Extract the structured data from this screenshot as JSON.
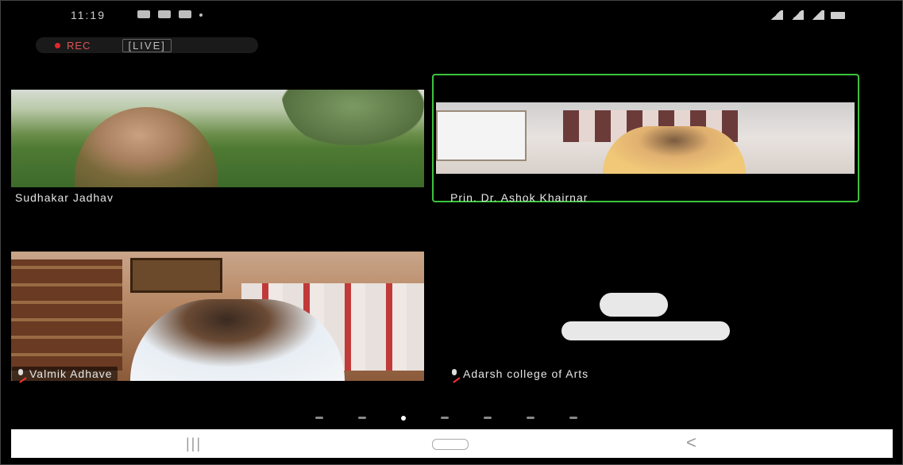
{
  "status_bar": {
    "time": "11:19"
  },
  "recording": {
    "rec_label": "REC",
    "live_label": "[LIVE]"
  },
  "participants": [
    {
      "name": "Sudhakar Jadhav"
    },
    {
      "name": "Prin. Dr. Ashok Khairnar",
      "active_speaker": true,
      "highlight_color": "#3cc43c"
    },
    {
      "name": "Valmik Adhave",
      "muted": true
    },
    {
      "name": "Adarsh college of  Arts",
      "muted": true,
      "video_off": true
    }
  ],
  "pager": {
    "total_pages": 7,
    "current_page": 3
  },
  "navigation": {
    "recents_icon": "recents-icon",
    "home_icon": "home-icon",
    "back_icon": "back-icon"
  }
}
